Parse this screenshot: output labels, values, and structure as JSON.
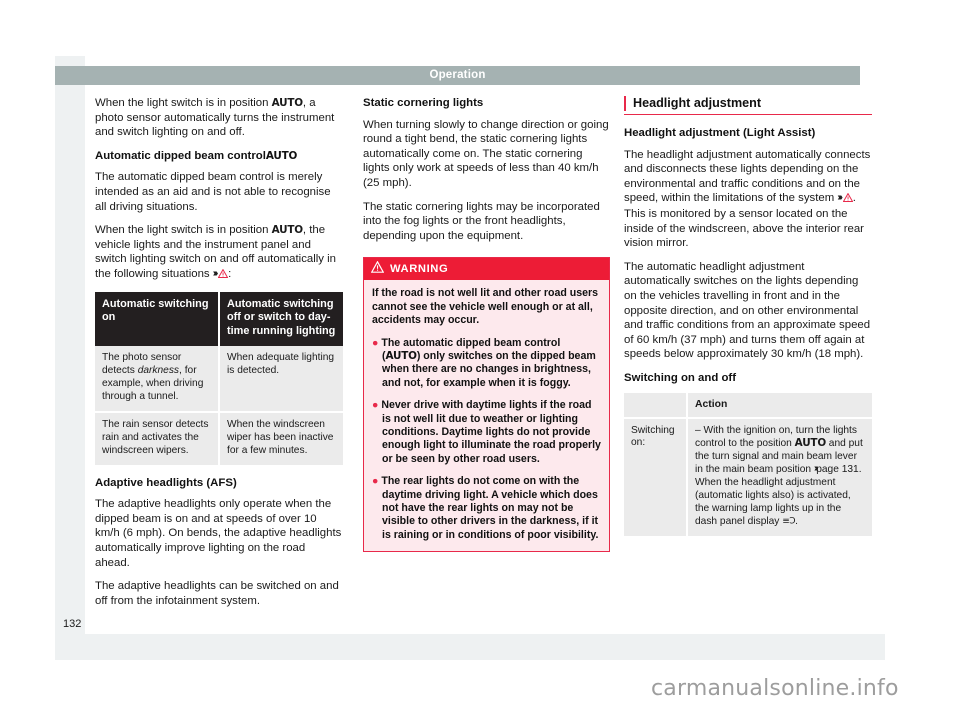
{
  "page": {
    "header_title": "Operation",
    "page_number": "132",
    "watermark": "carmanualsonline.info",
    "accent_red": "#e8294a",
    "warning_red": "#ed1c36",
    "header_bar_color": "#a5b2b2",
    "page_bg": "#eef1f2"
  },
  "left_column": {
    "intro_paragraph": "When the light switch is in position AUTO, a photo sensor automatically turns the instrument and switch lighting on and off.",
    "heading_auto_dipped": "Automatic dipped beam control",
    "heading_auto_dipped_badge": "AUTO",
    "para_auto_dipped": "The automatic dipped beam control is merely intended as an aid and is not able to recognise all driving situations.",
    "para_switch_position_pre": "When the light switch is in position ",
    "para_switch_position_badge": "AUTO",
    "para_switch_position_post": ", the vehicle lights and the instrument panel and switch lighting switch on and off automatically in the following situations ",
    "table": {
      "headers": [
        "Automatic switching on",
        "Automatic switching off or switch to day-time running lighting"
      ],
      "rows": [
        {
          "on_pre": "The photo sensor detects ",
          "on_italic": "darkness",
          "on_post": ", for example, when driving through a tunnel.",
          "off": "When adequate lighting is detected."
        },
        {
          "on_pre": "The rain sensor detects rain and activates the windscreen wipers.",
          "on_italic": "",
          "on_post": "",
          "off": "When the windscreen wiper has been inactive for a few minutes."
        }
      ]
    },
    "heading_afs": "Adaptive headlights (AFS)",
    "para_afs_1": "The adaptive headlights only operate when the dipped beam is on and at speeds of over 10 km/h (6 mph). On bends, the adaptive headlights automatically improve lighting on the road ahead.",
    "para_afs_2": "The adaptive headlights can be switched on and off from the infotainment system."
  },
  "middle_column": {
    "heading_static": "Static cornering lights",
    "para_static_1": "When turning slowly to change direction or going round a tight bend, the static cornering lights automatically come on. The static cornering lights only work at speeds of less than 40 km/h (25 mph).",
    "para_static_2": "The static cornering lights may be incorporated into the fog lights or the front headlights, depending upon the equipment.",
    "warning": {
      "label": "WARNING",
      "intro": "If the road is not well lit and other road users cannot see the vehicle well enough or at all, accidents may occur.",
      "bullets": [
        {
          "pre": "The automatic dipped beam control (",
          "badge": "AUTO",
          "post": ") only switches on the dipped beam when there are no changes in brightness, and not, for example when it is foggy."
        },
        {
          "pre": "Never drive with daytime lights if the road is not well lit due to weather or lighting conditions. Daytime lights do not provide enough light to illuminate the road properly or be seen by other road users.",
          "badge": "",
          "post": ""
        },
        {
          "pre": "The rear lights do not come on with the daytime driving light. A vehicle which does not have the rear lights on may not be visible to other drivers in the darkness, if it is raining or in conditions of poor visibility.",
          "badge": "",
          "post": ""
        }
      ]
    }
  },
  "right_column": {
    "section_title": "Headlight adjustment",
    "heading_light_assist": "Headlight adjustment (Light Assist)",
    "para_1_pre": "The headlight adjustment automatically connects and disconnects these lights depending on the environmental and traffic conditions and on the speed, within the limitations of the system ",
    "para_1_post": ". This is monitored by a sensor located on the inside of the windscreen, above the interior rear vision mirror.",
    "para_2": "The automatic headlight adjustment automatically switches on the lights depending on the vehicles travelling in front and in the opposite direction, and on other environmental and traffic conditions from an approximate speed of 60 km/h (37 mph) and turns them off again at speeds below approximately 30 km/h (18 mph).",
    "heading_switching": "Switching on and off",
    "table": {
      "headers": [
        "",
        "Action"
      ],
      "rows": [
        {
          "label": "Switching on:",
          "action_pre": "– With the ignition on, turn the lights control to the position ",
          "action_badge": "AUTO",
          "action_mid": " and put the turn signal and main beam lever in the main beam position ",
          "action_page": "page 131",
          "action_post": ". When the headlight adjustment (automatic lights also) is activated, the warning lamp lights up in the dash panel display ",
          "action_icon": "headlight-indicator-icon",
          "action_end": "."
        }
      ]
    }
  },
  "icons": {
    "chevron_ref": "›››",
    "warning_triangle": "warning-triangle-icon",
    "bullet_dot": "●",
    "headlight_glyph": "≡Ɔ"
  }
}
